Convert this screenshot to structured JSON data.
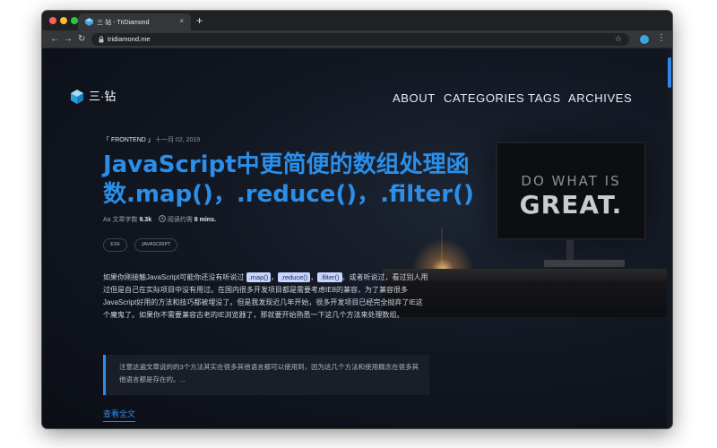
{
  "browser": {
    "tab_title": "三·钻 - TriDiamond",
    "tab_close": "×",
    "new_tab": "+",
    "back": "←",
    "forward": "→",
    "reload": "↻",
    "url": "tridiamond.me",
    "bookmark": "☆",
    "menu": "⋮"
  },
  "site": {
    "logo_text": "三·钻",
    "logo_icon": "diamond-icon",
    "nav": {
      "about": "ABOUT",
      "categories": "CATEGORIES",
      "tags": "TAGS",
      "archives": "ARCHIVES"
    }
  },
  "background": {
    "monitor_line1": "DO WHAT IS",
    "monitor_line2": "GREAT."
  },
  "post": {
    "category": "「 FRONTEND 」",
    "date": "十一月 02, 2019",
    "title": "JavaScript中更简便的数组处理函数.map()，.reduce()，.filter()",
    "word_count_icon": "Aa",
    "word_count_label": "文章字数",
    "word_count_value": "9.3k",
    "read_time_label": "阅读约需",
    "read_time_value": "8 mins.",
    "tags": [
      "ES6",
      "JAVASCRIPT"
    ],
    "excerpt": {
      "part1": "如果你刚接触JavaScript可能你还没有听说过 ",
      "code1": ".map()",
      "sep1": "，",
      "code2": ".reduce()",
      "sep2": "，",
      "code3": ".filter()",
      "part2": "。或者听说过，看过别人用过但是自己在实际项目中没有用过。在国内很多开发项目都是需要考虑IE8的兼容，为了兼容很多JavaScript好用的方法和技巧都被埋没了。但是我发现近几年开始，很多开发项目已经完全抛弃了IE这个魔鬼了。如果你不需要兼容古老的IE浏览器了，那就要开始熟悉一下这几个方法来处理数组。"
    },
    "note": "注意这遍文章说的的3个方法其实在很多其他语言都可以使用到，因为这几个方法和使用概念在很多其他语言都是存在的。...",
    "read_more": "查看全文"
  },
  "colors": {
    "accent": "#2b8ee8",
    "background": "#0d1117",
    "code_chip": "#c7d6ff"
  }
}
